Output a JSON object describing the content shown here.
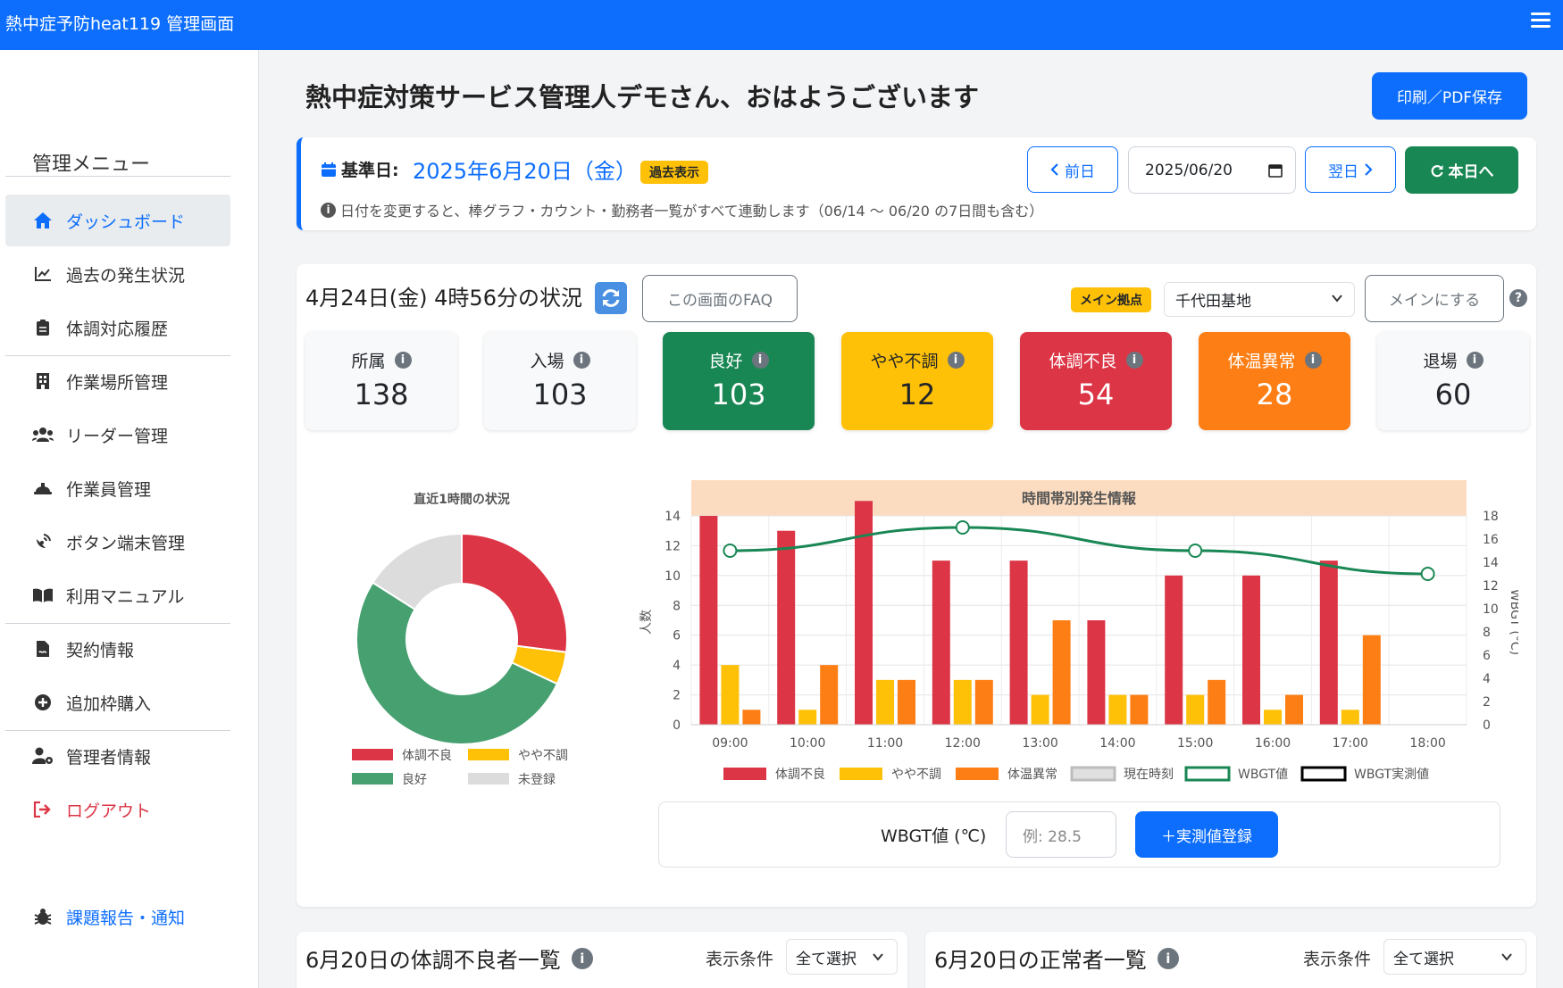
{
  "header": {
    "title": "熱中症予防heat119 管理画面"
  },
  "sidebar": {
    "heading": "管理メニュー",
    "items": [
      {
        "label": "ダッシュボード",
        "icon": "home-icon"
      },
      {
        "label": "過去の発生状況",
        "icon": "line-chart-icon"
      },
      {
        "label": "体調対応履歴",
        "icon": "clipboard-icon"
      },
      {
        "label": "作業場所管理",
        "icon": "building-icon"
      },
      {
        "label": "リーダー管理",
        "icon": "users-icon"
      },
      {
        "label": "作業員管理",
        "icon": "hard-hat-icon"
      },
      {
        "label": "ボタン端末管理",
        "icon": "satellite-dish-icon"
      },
      {
        "label": "利用マニュアル",
        "icon": "book-icon"
      },
      {
        "label": "契約情報",
        "icon": "file-contract-icon"
      },
      {
        "label": "追加枠購入",
        "icon": "plus-circle-icon"
      },
      {
        "label": "管理者情報",
        "icon": "user-gear-icon"
      },
      {
        "label": "ログアウト",
        "icon": "logout-icon"
      },
      {
        "label": "課題報告・通知",
        "icon": "bug-icon"
      }
    ]
  },
  "greeting": "熱中症対策サービス管理人デモさん、おはようございます",
  "print_button": "印刷／PDF保存",
  "datebar": {
    "label": "基準日:",
    "date": "2025年6月20日（金）",
    "badge": "過去表示",
    "hint": "日付を変更すると、棒グラフ・カウント・勤務者一覧がすべて連動します（06/14 〜 06/20 の7日間も含む）",
    "prev": "前日",
    "date_input": "2025/06/20",
    "next": "翌日",
    "today": "本日へ"
  },
  "status": {
    "title": "4月24日(金) 4時56分の状況",
    "faq_button": "この画面のFAQ",
    "main_badge": "メイン拠点",
    "site": "千代田基地",
    "set_main_button": "メインにする",
    "help": "?"
  },
  "stats": [
    {
      "label": "所属",
      "value": "138",
      "tone": "plain"
    },
    {
      "label": "入場",
      "value": "103",
      "tone": "plain"
    },
    {
      "label": "良好",
      "value": "103",
      "tone": "green"
    },
    {
      "label": "やや不調",
      "value": "12",
      "tone": "yellow"
    },
    {
      "label": "体調不良",
      "value": "54",
      "tone": "red"
    },
    {
      "label": "体温異常",
      "value": "28",
      "tone": "orange"
    },
    {
      "label": "退場",
      "value": "60",
      "tone": "plain"
    }
  ],
  "colors": {
    "red": "#dc3545",
    "yellow": "#ffc107",
    "orange": "#fd7e14",
    "green": "#198754",
    "gray": "#dcdcdc",
    "blue": "#0d6efd"
  },
  "chart_data": [
    {
      "type": "pie",
      "title": "直近1時間の状況",
      "labels": [
        "体調不良",
        "やや不調",
        "良好",
        "未登録"
      ],
      "values": [
        27,
        5,
        52,
        16
      ],
      "colors": [
        "#dc3545",
        "#ffc107",
        "#47a070",
        "#dcdcdc"
      ],
      "legend": "bottom"
    },
    {
      "type": "bar",
      "title": "時間帯別発生情報",
      "ylabel": "人数",
      "y2label": "WBGT (°C)",
      "categories": [
        "09:00",
        "10:00",
        "11:00",
        "12:00",
        "13:00",
        "14:00",
        "15:00",
        "16:00",
        "17:00",
        "18:00"
      ],
      "ylim": [
        0,
        14
      ],
      "y2lim": [
        0,
        18
      ],
      "series": [
        {
          "name": "体調不良",
          "values": [
            14,
            13,
            15,
            11,
            11,
            7,
            10,
            10,
            11,
            0
          ],
          "color": "#dc3545"
        },
        {
          "name": "やや不調",
          "values": [
            4,
            1,
            3,
            3,
            2,
            2,
            2,
            1,
            1,
            0
          ],
          "color": "#ffc107"
        },
        {
          "name": "体温異常",
          "values": [
            1,
            4,
            3,
            3,
            7,
            2,
            3,
            2,
            6,
            0
          ],
          "color": "#fd7e14"
        }
      ],
      "wbgt": {
        "name": "WBGT値",
        "x": [
          "09:00",
          "12:00",
          "15:00",
          "18:00"
        ],
        "values": [
          15,
          17,
          15,
          13
        ],
        "color": "#198754"
      },
      "legend_extra": [
        "現在時刻",
        "WBGT実測値"
      ],
      "legend": "bottom",
      "grid": true
    }
  ],
  "wbgt_form": {
    "label": "WBGT値 (℃)",
    "placeholder": "例: 28.5",
    "button": "＋実測値登録"
  },
  "lists": [
    {
      "title": "6月20日の体調不良者一覧",
      "filter_label": "表示条件",
      "filter_value": "全て選択"
    },
    {
      "title": "6月20日の正常者一覧",
      "filter_label": "表示条件",
      "filter_value": "全て選択"
    }
  ]
}
